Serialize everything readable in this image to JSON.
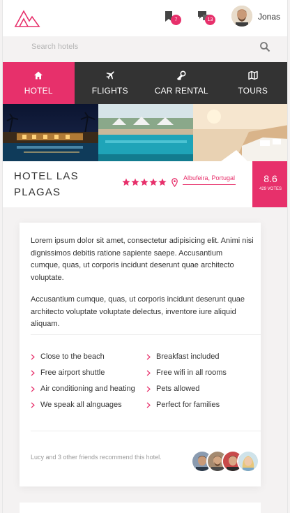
{
  "header": {
    "logo_name": "logo",
    "bookmark_count": "7",
    "messages_count": "13",
    "user_name": "Jonas"
  },
  "search": {
    "placeholder": "Search hotels"
  },
  "nav": [
    {
      "label": "HOTEL",
      "icon": "home-icon",
      "active": true
    },
    {
      "label": "FLIGHTS",
      "icon": "airplane-icon",
      "active": false
    },
    {
      "label": "CAR RENTAL",
      "icon": "key-icon",
      "active": false
    },
    {
      "label": "TOURS",
      "icon": "map-icon",
      "active": false
    }
  ],
  "hotel": {
    "title": "HOTEL LAS PLAGAS",
    "stars": 5,
    "location": "Albufeira, Portugal",
    "rating": "8.6",
    "votes": "429 VOTES"
  },
  "description": {
    "paragraph1": "Lorem ipsum dolor sit amet, consectetur adipisicing elit. Animi nisi dignissimos debitis ratione sapiente saepe. Accusantium cumque, quas, ut corporis incidunt deserunt quae architecto voluptate.",
    "paragraph2": "Accusantium cumque, quas, ut corporis incidunt deserunt quae architecto voluptate voluptate delectus, inventore iure aliquid aliquam."
  },
  "features": [
    "Close to the beach",
    "Breakfast included",
    "Free airport shuttle",
    "Free wifi in all rooms",
    "Air conditioning and heating",
    "Pets allowed",
    "We speak all alnguages",
    "Perfect for families"
  ],
  "recommend": {
    "text": "Lucy and 3 other friends recommend this hotel."
  },
  "colors": {
    "accent": "#e7306b",
    "nav_bg": "#333333",
    "page_bg": "#f4f2f2"
  }
}
